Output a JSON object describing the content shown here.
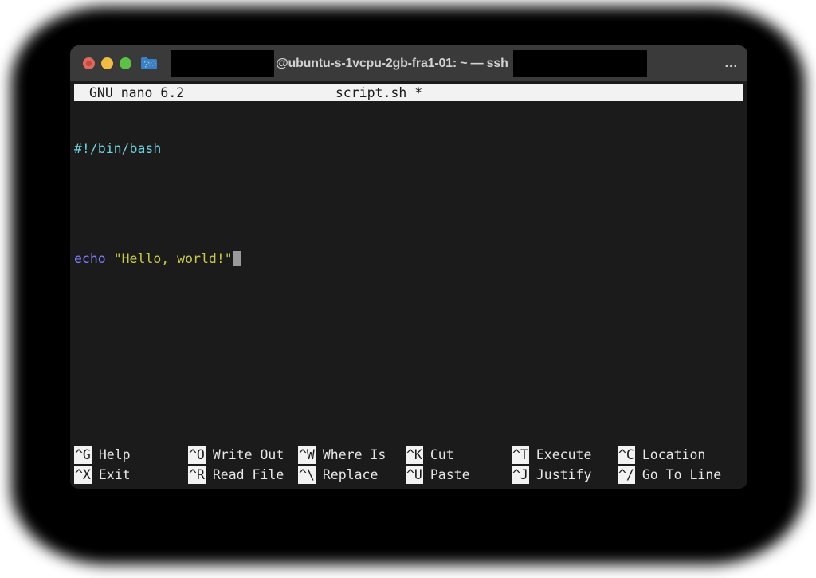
{
  "window": {
    "traffic_lights": [
      {
        "name": "close",
        "color": "#e0695f"
      },
      {
        "name": "minimize",
        "color": "#f0bd42"
      },
      {
        "name": "maximize",
        "color": "#5cc246"
      }
    ],
    "folder_icon": "folder-icon",
    "title": {
      "redacted_user": "",
      "host_path": "@ubuntu-s-1vcpu-2gb-fra1-01: ~ — ssh ",
      "redacted_tail": "",
      "overflow": "..."
    }
  },
  "nano": {
    "header": {
      "version": "GNU nano 6.2",
      "filename": "script.sh *"
    },
    "editor": {
      "lines": [
        {
          "type": "shebang",
          "text": "#!/bin/bash"
        },
        {
          "type": "blank",
          "text": ""
        },
        {
          "type": "code",
          "keyword": "echo",
          "space": " ",
          "string": "\"Hello, world!\""
        }
      ],
      "cursor": "block-cursor"
    },
    "shortcuts": [
      [
        {
          "key": "^G",
          "label": "Help"
        },
        {
          "key": "^X",
          "label": "Exit"
        }
      ],
      [
        {
          "key": "^O",
          "label": "Write Out"
        },
        {
          "key": "^R",
          "label": "Read File"
        }
      ],
      [
        {
          "key": "^W",
          "label": "Where Is"
        },
        {
          "key": "^\\",
          "label": "Replace"
        }
      ],
      [
        {
          "key": "^K",
          "label": "Cut"
        },
        {
          "key": "^U",
          "label": "Paste"
        }
      ],
      [
        {
          "key": "^T",
          "label": "Execute"
        },
        {
          "key": "^J",
          "label": "Justify"
        }
      ],
      [
        {
          "key": "^C",
          "label": "Location"
        },
        {
          "key": "^/",
          "label": "Go To Line"
        }
      ]
    ]
  },
  "colors": {
    "titlebar": "#3a3a3a",
    "terminal_bg": "#1b1b1b",
    "inverse_bg": "#f2f2f2",
    "shebang": "#6fd1e0",
    "keyword": "#7d7dfb",
    "string": "#c9c94a",
    "cursor": "#9a9a9a"
  }
}
